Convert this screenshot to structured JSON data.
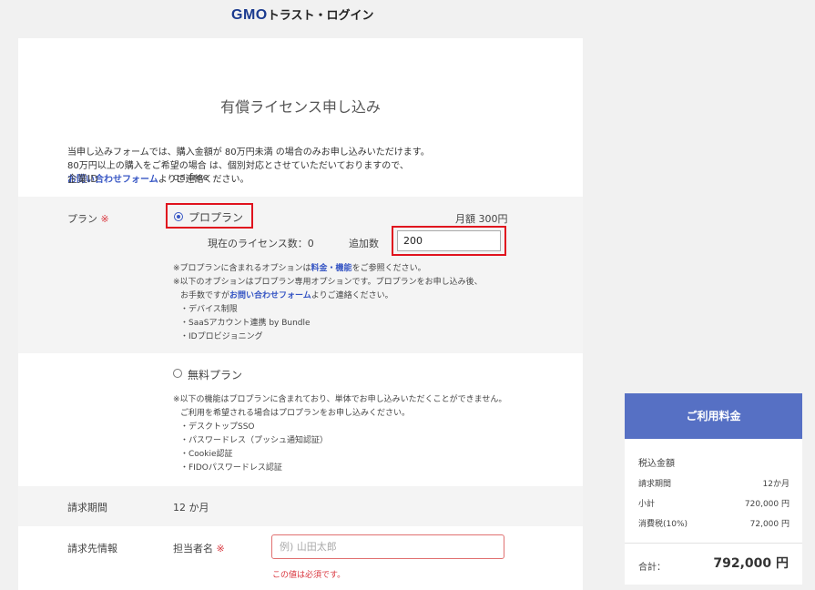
{
  "header": {
    "logo_gmo": "GMO",
    "logo_rest": "トラスト・ログイン"
  },
  "form": {
    "title": "有償ライセンス申し込み",
    "intro": {
      "line1": "当申し込みフォームでは、購入金額が 80万円未満 の場合のみお申し込みいただけます。",
      "line2": "80万円以上の購入をご希望の場合 は、個別対応とさせていただいておりますので、",
      "line3_link": "お問い合わせフォーム",
      "line3_rest": "よりご連絡ください。"
    },
    "company": {
      "label": "企業ID",
      "value": "qa-free"
    },
    "plan": {
      "label": "プラン",
      "required_mark": "※",
      "pro": {
        "label": "プロプラン",
        "price": "月額 300円",
        "current_label": "現在のライセンス数：0",
        "add_label": "追加数",
        "add_value": "200",
        "note1_pre": "※プロプランに含まれるオプションは",
        "note1_link": "料金・機能",
        "note1_post": "をご参照ください。",
        "note2": "※以下のオプションはプロプラン専用オプションです。プロプランをお申し込み後、",
        "note3_pre": "お手数ですが",
        "note3_link": "お問い合わせフォーム",
        "note3_post": "よりご連絡ください。",
        "options": [
          "・デバイス制限",
          "・SaaSアカウント連携 by Bundle",
          "・IDプロビジョニング"
        ]
      },
      "free": {
        "label": "無料プラン",
        "note1": "※以下の機能はプロプランに含まれており、単体でお申し込みいただくことができません。",
        "note2": "ご利用を希望される場合はプロプランをお申し込みください。",
        "options": [
          "・デスクトップSSO",
          "・パスワードレス（プッシュ通知認証）",
          "・Cookie認証",
          "・FIDOパスワードレス認証"
        ]
      }
    },
    "billing_period": {
      "label": "請求期間",
      "value": "12 か月"
    },
    "billing_info": {
      "label": "請求先情報",
      "contact_label": "担当者名",
      "required_mark": "※",
      "placeholder": "例) 山田太郎",
      "error": "この値は必須です。"
    }
  },
  "summary": {
    "heading": "ご利用料金",
    "title": "税込金額",
    "rows": [
      {
        "label": "請求期間",
        "value": "12か月"
      },
      {
        "label": "小計",
        "value": "720,000 円"
      },
      {
        "label": "消費税(10%)",
        "value": "72,000 円"
      }
    ],
    "total_label": "合計：",
    "total_value": "792,000 円"
  }
}
